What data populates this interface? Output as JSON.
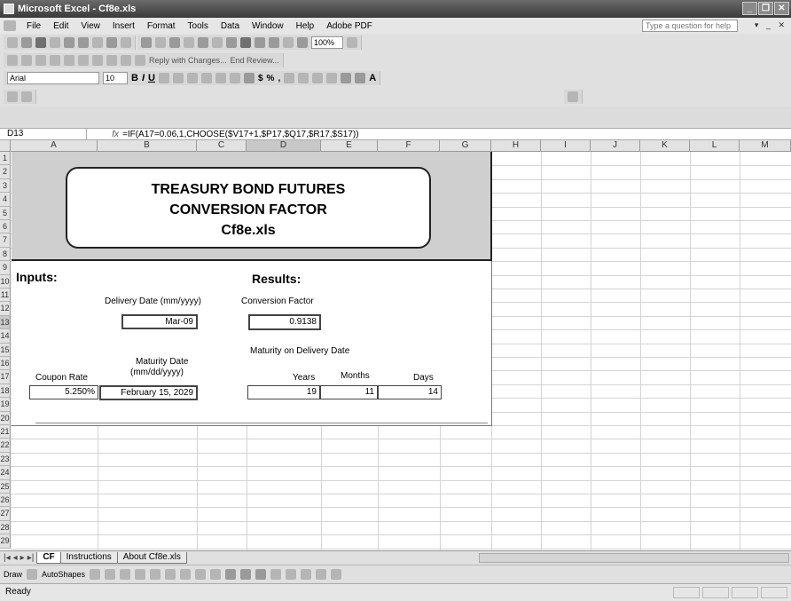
{
  "window": {
    "title": "Microsoft Excel - Cf8e.xls"
  },
  "menu": {
    "items": [
      "File",
      "Edit",
      "View",
      "Insert",
      "Format",
      "Tools",
      "Data",
      "Window",
      "Help",
      "Adobe PDF"
    ],
    "help_placeholder": "Type a question for help"
  },
  "toolbar": {
    "zoom": "100%",
    "reply_text": "Reply with Changes...",
    "end_review": "End Review...",
    "font_name": "Arial",
    "font_size": "10"
  },
  "formula_bar": {
    "name_box": "D13",
    "fx": "fx",
    "formula": "=IF(A17=0.06,1,CHOOSE($V17+1,$P17,$Q17,$R17,$S17))"
  },
  "columns": [
    "A",
    "B",
    "C",
    "D",
    "E",
    "F",
    "G",
    "H",
    "I",
    "J",
    "K",
    "L",
    "M"
  ],
  "rows": [
    "1",
    "2",
    "3",
    "4",
    "5",
    "6",
    "7",
    "8",
    "9",
    "10",
    "11",
    "12",
    "13",
    "14",
    "15",
    "16",
    "17",
    "18",
    "19",
    "20",
    "21",
    "22",
    "23",
    "24",
    "25",
    "26",
    "27",
    "28",
    "29"
  ],
  "sheet": {
    "title_lines": [
      "TREASURY BOND FUTURES",
      "CONVERSION FACTOR",
      "Cf8e.xls"
    ],
    "inputs_label": "Inputs:",
    "results_label": "Results:",
    "delivery_date_label": "Delivery Date (mm/yyyy)",
    "delivery_date_value": "Mar-09",
    "conversion_factor_label": "Conversion Factor",
    "conversion_factor_value": "0.9138",
    "maturity_on_delivery_label": "Maturity on Delivery Date",
    "maturity_date_label_1": "Maturity Date",
    "maturity_date_label_2": "(mm/dd/yyyy)",
    "coupon_rate_label": "Coupon Rate",
    "coupon_rate_value": "5.250%",
    "maturity_date_value": "February 15, 2029",
    "years_label": "Years",
    "months_label": "Months",
    "days_label": "Days",
    "years_value": "19",
    "months_value": "11",
    "days_value": "14"
  },
  "tabs": [
    {
      "label": "CF",
      "active": true
    },
    {
      "label": "Instructions",
      "active": false
    },
    {
      "label": "About Cf8e.xls",
      "active": false
    }
  ],
  "drawing": {
    "draw_label": "Draw",
    "autoshapes_label": "AutoShapes"
  },
  "status": {
    "text": "Ready"
  }
}
